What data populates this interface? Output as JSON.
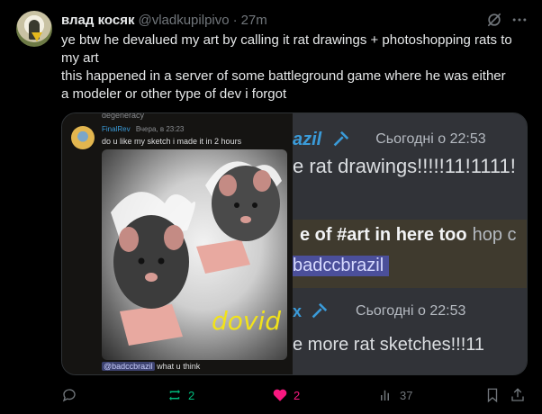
{
  "tweet": {
    "author_name": "влад косяк",
    "handle": "@vladkupilpivo",
    "separator": "·",
    "time": "27m",
    "text_lines": [
      "ye btw he devalued my art by calling it rat drawings + photoshopping rats to",
      "my art",
      "this happened in a server of some battleground game where he was either",
      "a modeler or other type of dev i forgot"
    ]
  },
  "media": {
    "left": {
      "top_label": "degeneracy",
      "username": "FinalRev",
      "timestamp": "Вчера, в 23:23",
      "message": "do u like my sketch i made it in 2 hours",
      "signature": "dovid",
      "mention": "@badccbrazil",
      "after_mention": " what u think"
    },
    "right": {
      "name1": "azil",
      "timestamp1": "Сьогодні о 22:53",
      "line1": "e rat drawings!!!!!11!1111!",
      "line2_bold": "e of #art in here too",
      "line2_rest": "hop c",
      "mention": "badccbrazil",
      "name2": "x",
      "timestamp2": "Сьогодні о 22:53",
      "line3": "e more rat sketches!!!11"
    }
  },
  "actions": {
    "replies": "",
    "reposts": "2",
    "likes": "2",
    "views": "37"
  },
  "colors": {
    "background": "#000000",
    "repost_green": "#00ba7c",
    "like_pink": "#f91880",
    "muted": "#71767b"
  }
}
